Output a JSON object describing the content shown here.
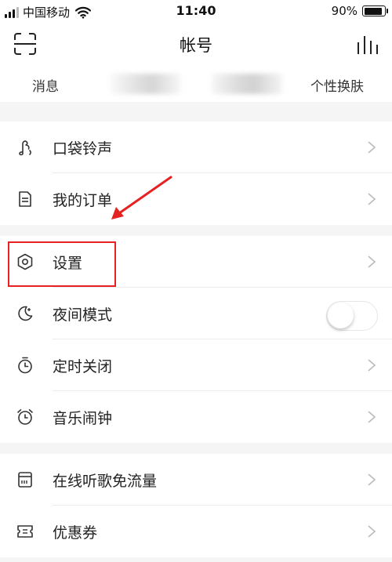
{
  "status_bar": {
    "carrier": "中国移动",
    "time": "11:40",
    "battery": "90%",
    "battery_level": 0.9
  },
  "nav": {
    "title": "帐号",
    "left_icon": "scan-icon",
    "right_icon": "stats-icon"
  },
  "tabs": {
    "messages": "消息",
    "skin": "个性换肤"
  },
  "menu": {
    "ringtone": "口袋铃声",
    "orders": "我的订单",
    "settings": "设置",
    "night_mode": "夜间模式",
    "timer_close": "定时关闭",
    "alarm": "音乐闹钟",
    "free_data": "在线听歌免流量",
    "coupons": "优惠券"
  },
  "night_mode_enabled": false,
  "annotation": {
    "color": "#e62121"
  }
}
